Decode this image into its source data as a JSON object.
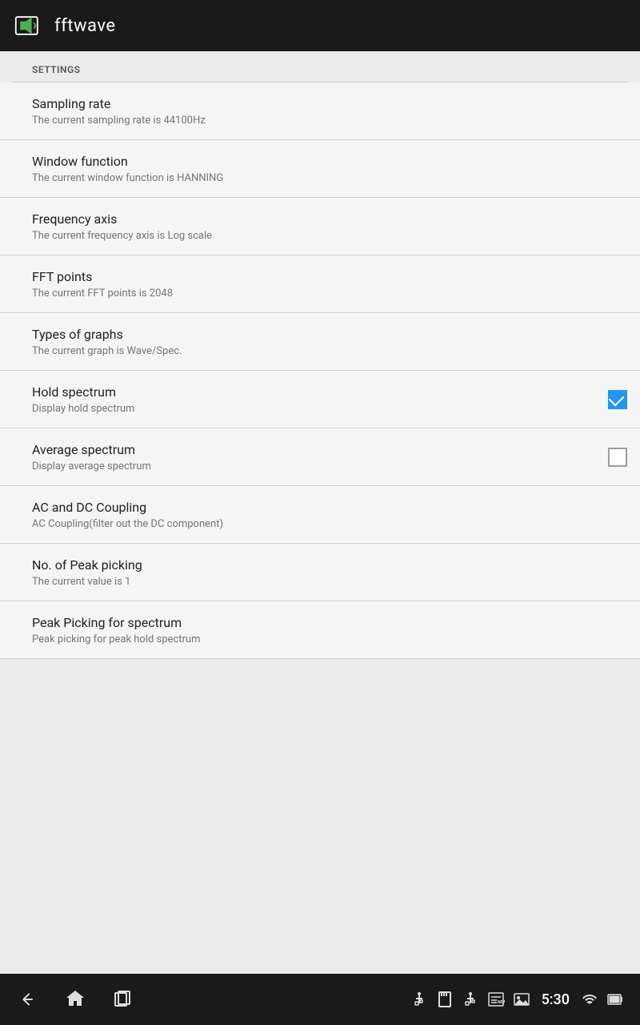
{
  "appBar": {
    "title": "fftwave",
    "iconAlt": "fftwave-logo"
  },
  "settings": {
    "header": "SETTINGS",
    "items": [
      {
        "id": "sampling-rate",
        "title": "Sampling rate",
        "subtitle": "The current sampling rate is 44100Hz",
        "hasControl": false
      },
      {
        "id": "window-function",
        "title": "Window function",
        "subtitle": "The current window function is HANNING",
        "hasControl": false
      },
      {
        "id": "frequency-axis",
        "title": "Frequency axis",
        "subtitle": "The current frequency axis is Log scale",
        "hasControl": false
      },
      {
        "id": "fft-points",
        "title": "FFT points",
        "subtitle": "The current FFT points is 2048",
        "hasControl": false
      },
      {
        "id": "types-of-graphs",
        "title": "Types of graphs",
        "subtitle": "The current graph is Wave/Spec.",
        "hasControl": false
      },
      {
        "id": "hold-spectrum",
        "title": "Hold spectrum",
        "subtitle": "Display hold spectrum",
        "hasControl": true,
        "checked": true
      },
      {
        "id": "average-spectrum",
        "title": "Average spectrum",
        "subtitle": "Display average spectrum",
        "hasControl": true,
        "checked": false
      },
      {
        "id": "ac-dc-coupling",
        "title": "AC and DC Coupling",
        "subtitle": "AC Coupling(filter out the DC component)",
        "hasControl": false
      },
      {
        "id": "no-peak-picking",
        "title": "No. of Peak picking",
        "subtitle": "The current value is 1",
        "hasControl": false
      },
      {
        "id": "peak-picking-spectrum",
        "title": "Peak Picking for spectrum",
        "subtitle": "Peak picking for peak hold spectrum",
        "hasControl": false
      }
    ]
  },
  "navBar": {
    "statusTime": "5:30"
  }
}
